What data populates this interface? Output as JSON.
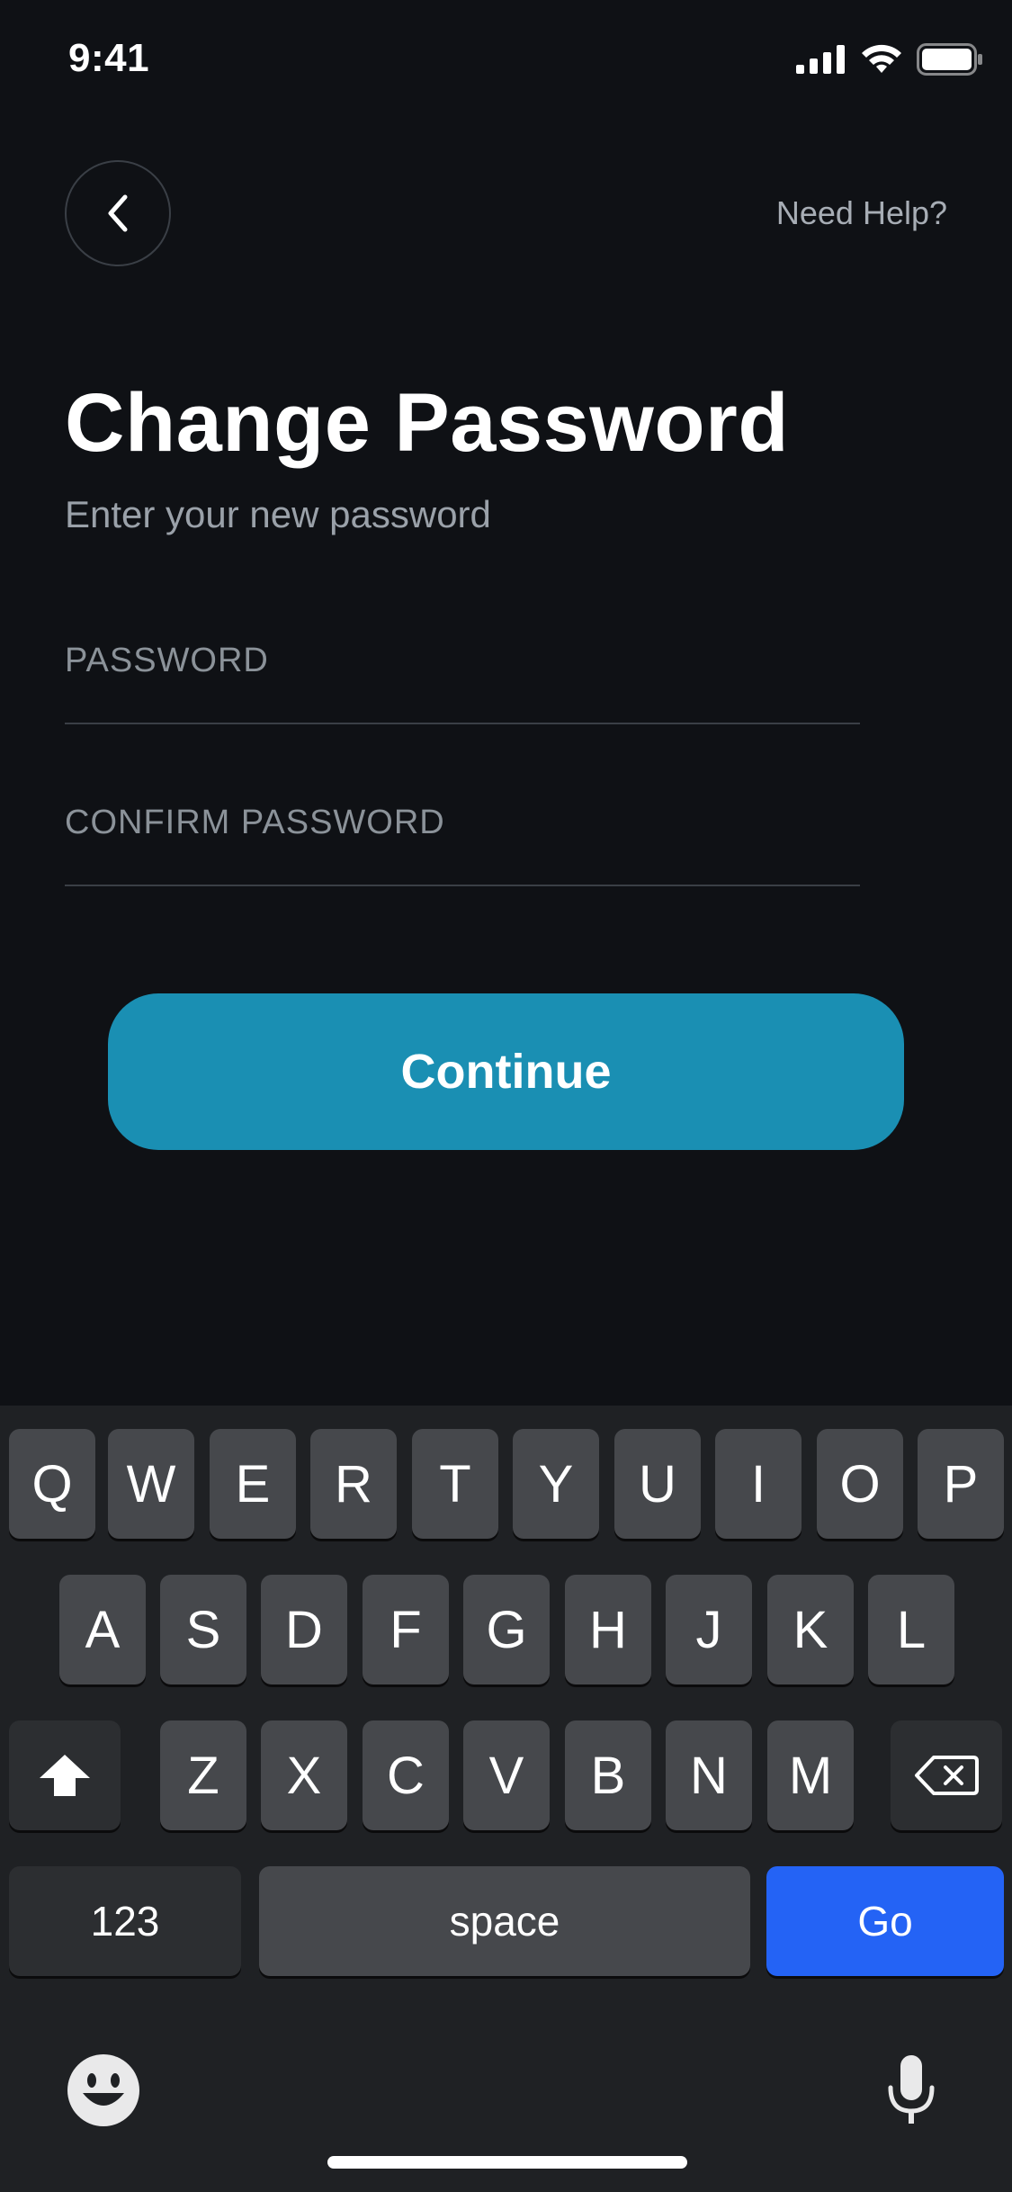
{
  "status_bar": {
    "time": "9:41"
  },
  "header": {
    "help_label": "Need Help?"
  },
  "page": {
    "title": "Change Password",
    "subtitle": "Enter your new password"
  },
  "form": {
    "password_label": "PASSWORD",
    "confirm_label": "CONFIRM PASSWORD",
    "continue_label": "Continue"
  },
  "keyboard": {
    "row1": [
      "Q",
      "W",
      "E",
      "R",
      "T",
      "Y",
      "U",
      "I",
      "O",
      "P"
    ],
    "row2": [
      "A",
      "S",
      "D",
      "F",
      "G",
      "H",
      "J",
      "K",
      "L"
    ],
    "row3": [
      "Z",
      "X",
      "C",
      "V",
      "B",
      "N",
      "M"
    ],
    "numbers_label": "123",
    "space_label": "space",
    "go_label": "Go",
    "icons": {
      "shift": "shift-icon",
      "delete": "delete-icon",
      "emoji": "emoji-icon",
      "mic": "microphone-icon"
    }
  },
  "colors": {
    "background": "#0f1115",
    "accent": "#1a8fb3",
    "go_key": "#2463f5"
  }
}
